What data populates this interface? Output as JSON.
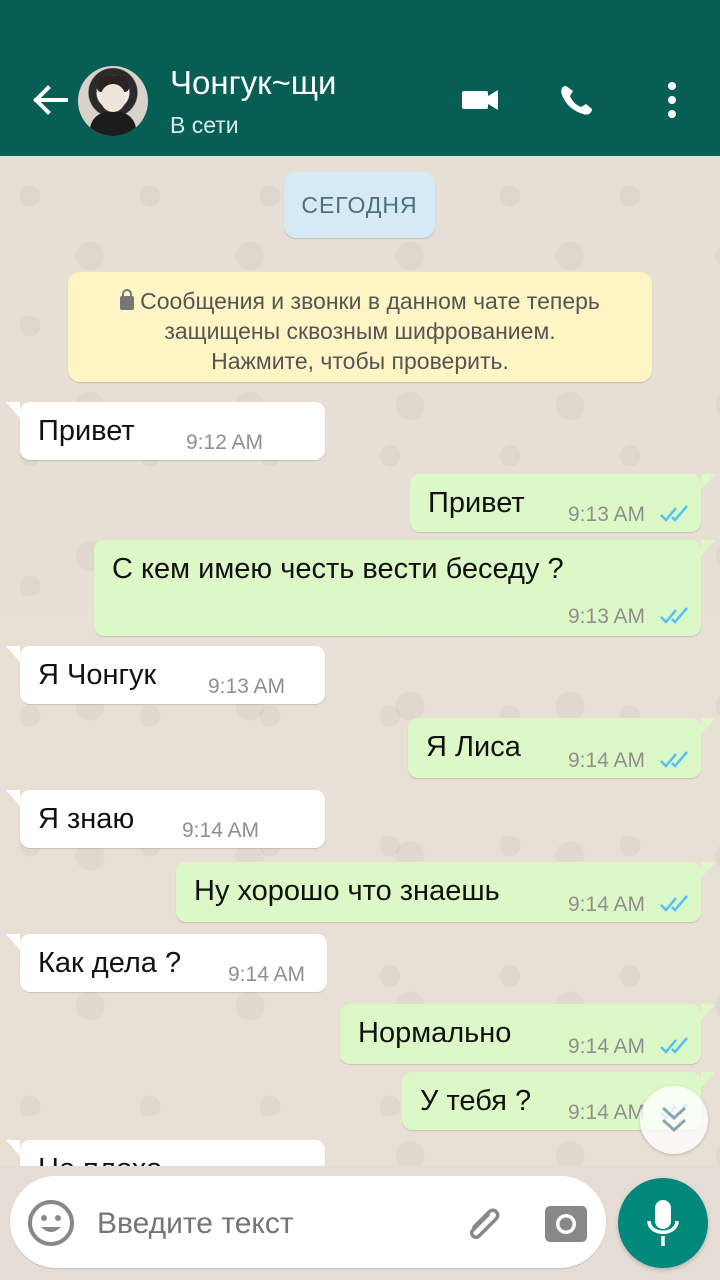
{
  "header": {
    "contact_name": "Чонгук~щи",
    "status": "В сети"
  },
  "chat": {
    "date_label": "СЕГОДНЯ",
    "notice_lines": [
      "Сообщения и звонки в данном чате теперь",
      "защищены сквозным шифрованием.",
      "Нажмите, чтобы проверить."
    ],
    "messages": [
      {
        "direction": "incoming",
        "text": "Привет",
        "time": "9:12 AM"
      },
      {
        "direction": "outgoing",
        "text": "Привет",
        "time": "9:13 AM",
        "read": true
      },
      {
        "direction": "outgoing",
        "text": "С кем имею честь вести беседу ?",
        "time": "9:13 AM",
        "read": true
      },
      {
        "direction": "incoming",
        "text": "Я Чонгук",
        "time": "9:13 AM"
      },
      {
        "direction": "outgoing",
        "text": "Я Лиса",
        "time": "9:14 AM",
        "read": true
      },
      {
        "direction": "incoming",
        "text": "Я знаю",
        "time": "9:14 AM"
      },
      {
        "direction": "outgoing",
        "text": "Ну хорошо что знаешь",
        "time": "9:14 AM",
        "read": true
      },
      {
        "direction": "incoming",
        "text": "Как дела ?",
        "time": "9:14 AM"
      },
      {
        "direction": "outgoing",
        "text": "Нормально",
        "time": "9:14 AM",
        "read": true
      },
      {
        "direction": "outgoing",
        "text": "У тебя ?",
        "time": "9:14 AM",
        "read": true
      }
    ],
    "partial_message_text": "Не плохо"
  },
  "composer": {
    "placeholder": "Введите текст"
  },
  "icons": {
    "back": "back-arrow-icon",
    "video": "video-call-icon",
    "phone": "phone-call-icon",
    "menu": "more-vert-icon",
    "emoji": "emoji-icon",
    "attach": "paperclip-icon",
    "camera": "camera-icon",
    "mic": "microphone-icon",
    "scroll_down": "double-chevron-down-icon"
  },
  "colors": {
    "header": "#075e54",
    "incoming_bubble": "#ffffff",
    "outgoing_bubble": "#dcf8c6",
    "read_ticks": "#4fc3f7",
    "mic_button": "#00897b"
  }
}
